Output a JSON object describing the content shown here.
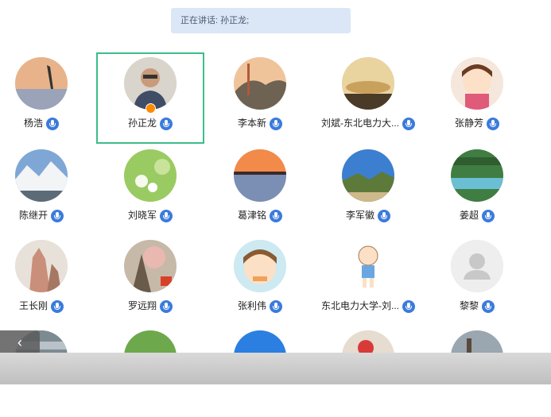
{
  "speaking": {
    "label": "正在讲话: 孙正龙;"
  },
  "participants": [
    {
      "name": "杨浩"
    },
    {
      "name": "孙正龙"
    },
    {
      "name": "李本新"
    },
    {
      "name": "刘斌-东北电力大..."
    },
    {
      "name": "张静芳"
    },
    {
      "name": "陈继开"
    },
    {
      "name": "刘晓军"
    },
    {
      "name": "葛津铭"
    },
    {
      "name": "李军徽"
    },
    {
      "name": "姜超"
    },
    {
      "name": "王长刚"
    },
    {
      "name": "罗远翔"
    },
    {
      "name": "张利伟"
    },
    {
      "name": "东北电力大学-刘..."
    },
    {
      "name": "黎黎"
    }
  ],
  "colors": {
    "active_border": "#3cbd8a",
    "mic": "#3a7bdc",
    "host_badge": "#ff8a00"
  },
  "icons": {
    "mic": "microphone-icon",
    "host": "host-badge-icon",
    "collapse": "chevron-left-icon"
  }
}
